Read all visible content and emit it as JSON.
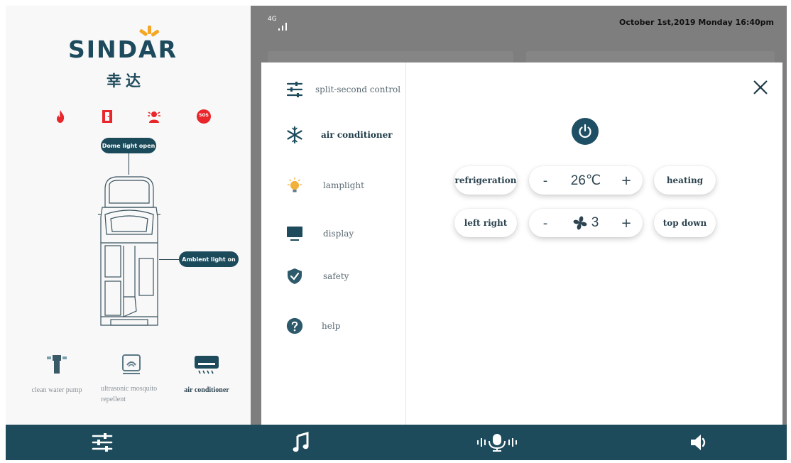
{
  "brand": {
    "logo": "SINDAR",
    "logo_cn": "幸达"
  },
  "car_labels": {
    "dome": "Dome light open",
    "ambient": "Ambient light on"
  },
  "alerts": [
    {
      "name": "fire-icon",
      "color": "#e8262b"
    },
    {
      "name": "door-icon",
      "color": "#e8262b"
    },
    {
      "name": "person-alarm-icon",
      "color": "#e8262b"
    },
    {
      "name": "sos-icon",
      "label": "SOS",
      "color": "#e8262b"
    }
  ],
  "devices": [
    {
      "label": "clean water pump",
      "icon": "water-pump-icon",
      "active": false
    },
    {
      "label": "ultrasonic mosquito repellent",
      "icon": "ultrasonic-icon",
      "active": false
    },
    {
      "label": "air conditioner",
      "icon": "air-conditioner-icon",
      "active": true
    }
  ],
  "status": {
    "network": "4G",
    "datetime": "October 1st,2019 Monday 16:40pm"
  },
  "menu": [
    {
      "label": "split-second control",
      "icon": "sliders-icon"
    },
    {
      "label": "air conditioner",
      "icon": "snowflake-icon",
      "active": true
    },
    {
      "label": "lamplight",
      "icon": "bulb-icon"
    },
    {
      "label": "display",
      "icon": "monitor-icon"
    },
    {
      "label": "safety",
      "icon": "shield-icon"
    },
    {
      "label": "help",
      "icon": "help-icon"
    }
  ],
  "ac": {
    "mode_left": "refrigeration",
    "mode_right": "heating",
    "minus": "-",
    "plus": "+",
    "temperature": "26℃",
    "dir_left": "left right",
    "dir_right": "top down",
    "fan_level": "3"
  },
  "bottom_tabs": [
    "sliders-icon",
    "music-icon",
    "voice-icon",
    "speaker-icon"
  ],
  "colors": {
    "primary": "#1d4b5c",
    "alert": "#e8262b",
    "dim": "#7e7e7e"
  }
}
